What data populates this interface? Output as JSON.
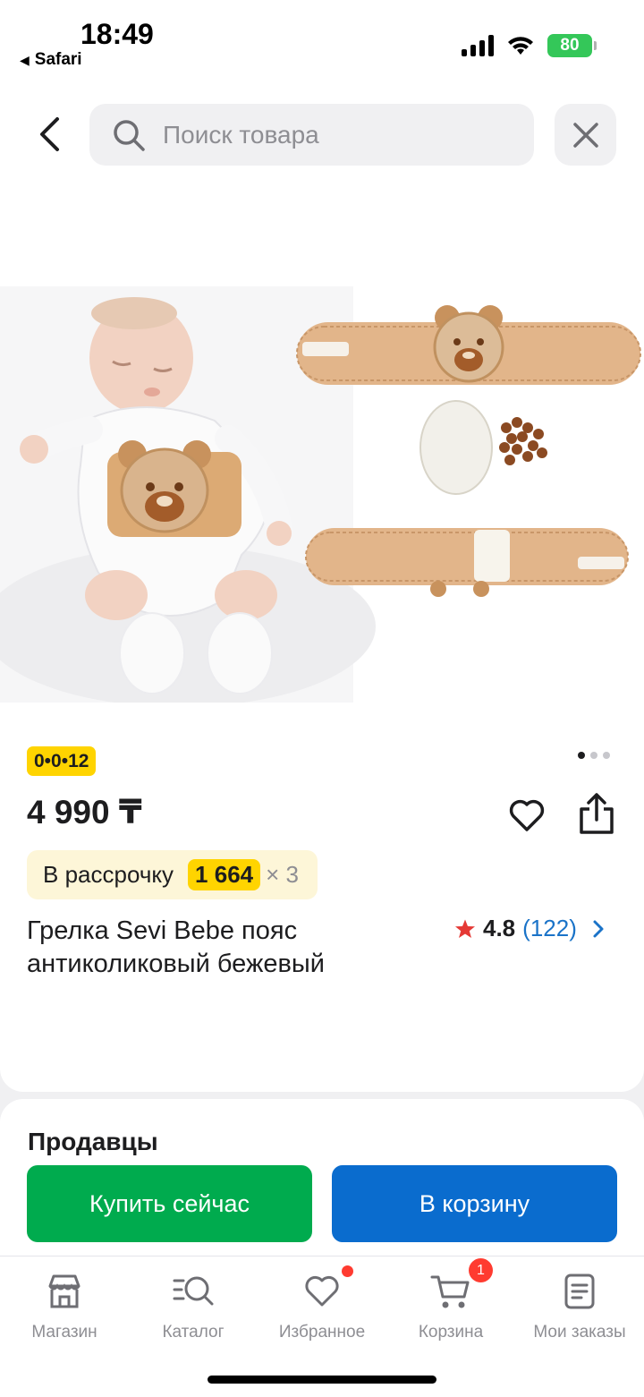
{
  "status_bar": {
    "time": "18:49",
    "back_app": "Safari",
    "battery": "80"
  },
  "search": {
    "placeholder": "Поиск товара"
  },
  "product": {
    "badge": "0•0•12",
    "price": "4 990 ₸",
    "installment": {
      "label": "В рассрочку",
      "amount": "1 664",
      "multiplier": "× 3"
    },
    "title": "Грелка Sevi Bebe пояс антиколиковый бежевый",
    "rating": "4.8",
    "reviews": "(122)",
    "image_count": 3,
    "active_image": 1
  },
  "sellers": {
    "title": "Продавцы"
  },
  "actions": {
    "buy_now": "Купить сейчас",
    "add_to_cart": "В корзину"
  },
  "tab_bar": {
    "items": [
      {
        "label": "Магазин",
        "icon": "store-icon"
      },
      {
        "label": "Каталог",
        "icon": "catalog-search-icon"
      },
      {
        "label": "Избранное",
        "icon": "heart-icon"
      },
      {
        "label": "Корзина",
        "icon": "cart-icon"
      },
      {
        "label": "Мои заказы",
        "icon": "orders-icon"
      }
    ],
    "cart_count": "1"
  },
  "colors": {
    "buy_button": "#00ab4e",
    "cart_button": "#0a6cce",
    "badge_yellow": "#ffd400",
    "rating_star": "#e53935",
    "notification_red": "#ff3b30"
  }
}
